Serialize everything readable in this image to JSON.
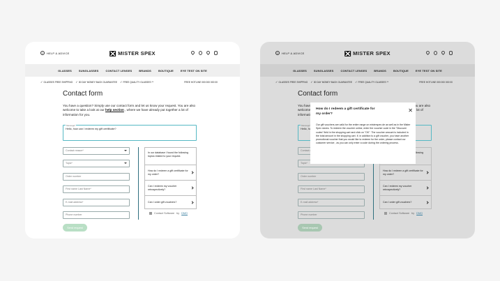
{
  "header": {
    "help": "HELP & ADVICE",
    "brand": "MISTER SPEX"
  },
  "nav": [
    "GLASSES",
    "SUNGLASSES",
    "CONTACT LENSES",
    "BRANDS",
    "BOUTIQUE",
    "EYE TEST ON SITE"
  ],
  "perks": {
    "p1": "GLASSES FREE SHIPPING",
    "p2": "30 DAY MONEY BACK GUARANTEE",
    "p3": "FREE QUALITY GLASSES **",
    "hotline": "FREE HOTLINE 000 000 000 00"
  },
  "page": {
    "title": "Contact form",
    "intro_pre": "You have a question? Simply use our contact form and let us know your request. You are also welcome to take a look at our ",
    "intro_link": "help section",
    "intro_post": " , where we have already put together a lot of information for you."
  },
  "form": {
    "message_label": "Message*",
    "message_value": "Hello, how can I redeem my gift certificate?",
    "reason": "Contact reason*",
    "topic": "Topic*",
    "order": "Order number",
    "name": "First name Last Name*",
    "email": "E-mail address*",
    "phone": "Phone number",
    "send": "Send request"
  },
  "faq": {
    "intro": "In our database I found the following topics related to your request.",
    "items": [
      "How do I redeem a gift certificate for my order?",
      "Can I redeem my voucher retrospectively?",
      "Can I order gift vouchers?"
    ],
    "software_pre": "Contact Software",
    "software_by": "by",
    "software_brand": "DMO"
  },
  "modal": {
    "title": "How do I redeem a gift certificate for my order?",
    "body": "Our gift vouchers are valid for the entire range on misterspex.de as well as in the Mister Spex stores. To redeem the voucher online, enter the voucher code in the \"Discount codes\" field in the shopping cart and click on \"OK\". The voucher amount is included in the total amount in the shopping cart. If, in addition to a gift voucher, you have another promotional voucher that you would like to redeem for the order, please contact our customer service , as you can only enter a code during the ordering process."
  },
  "colors": {
    "accent": "#55b8c4",
    "divider": "#2e6f7e",
    "send": "#b9dfc5"
  }
}
